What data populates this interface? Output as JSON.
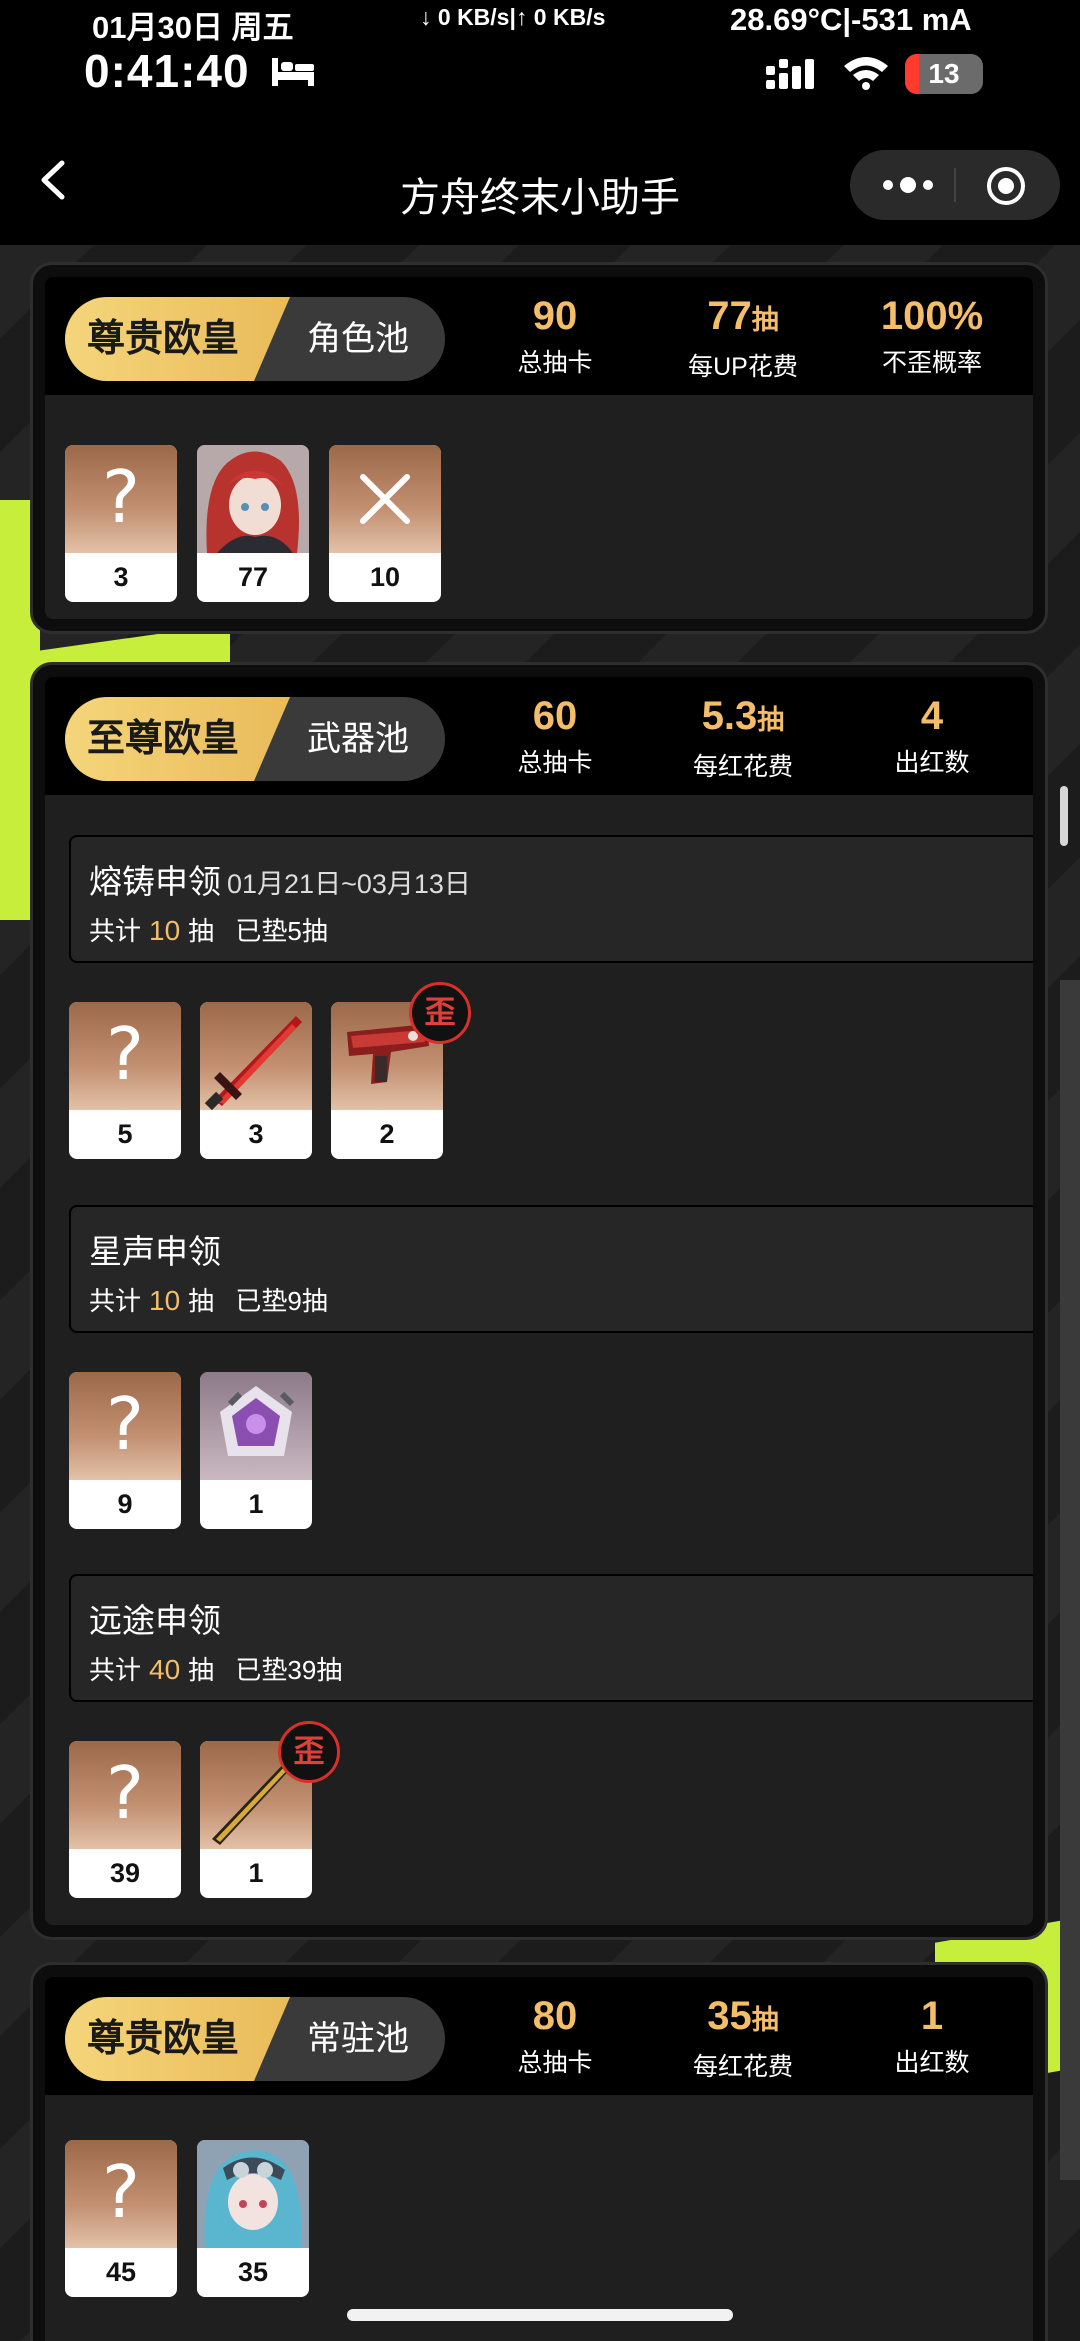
{
  "status_bar": {
    "date": "01月30日 周五",
    "time": "0:41:40",
    "network": "↓ 0 KB/s|↑ 0 KB/s",
    "temp_current": "28.69°C|-531 mA",
    "battery": "13"
  },
  "nav": {
    "title": "方舟终末小助手"
  },
  "cards": [
    {
      "rank": "尊贵欧皇",
      "pool": "角色池",
      "stats": [
        {
          "value": "90",
          "unit": "",
          "label": "总抽卡"
        },
        {
          "value": "77",
          "unit": "抽",
          "label": "每UP花费"
        },
        {
          "value": "100%",
          "unit": "",
          "label": "不歪概率"
        }
      ],
      "items": [
        {
          "type": "unknown",
          "glyph": "?",
          "count": "3"
        },
        {
          "type": "character-red-hair",
          "count": "77"
        },
        {
          "type": "cross",
          "glyph": "✕",
          "count": "10"
        }
      ]
    },
    {
      "rank": "至尊欧皇",
      "pool": "武器池",
      "stats": [
        {
          "value": "60",
          "unit": "",
          "label": "总抽卡"
        },
        {
          "value": "5.3",
          "unit": "抽",
          "label": "每红花费"
        },
        {
          "value": "4",
          "unit": "",
          "label": "出红数"
        }
      ],
      "banners": [
        {
          "name": "熔铸申领",
          "date": "01月21日~03月13日",
          "total_prefix": "共计",
          "total": "10",
          "total_unit": "抽",
          "pity": "已垫5抽",
          "items": [
            {
              "type": "unknown",
              "glyph": "?",
              "count": "5"
            },
            {
              "type": "red-sword",
              "count": "3"
            },
            {
              "type": "red-gun",
              "count": "2",
              "badge": "歪"
            }
          ]
        },
        {
          "name": "星声申领",
          "date": "",
          "total_prefix": "共计",
          "total": "10",
          "total_unit": "抽",
          "pity": "已垫9抽",
          "items": [
            {
              "type": "unknown",
              "glyph": "?",
              "count": "9"
            },
            {
              "type": "purple-gadget",
              "count": "1"
            }
          ]
        },
        {
          "name": "远途申领",
          "date": "",
          "total_prefix": "共计",
          "total": "40",
          "total_unit": "抽",
          "pity": "已垫39抽",
          "items": [
            {
              "type": "unknown",
              "glyph": "?",
              "count": "39"
            },
            {
              "type": "gold-staff",
              "count": "1",
              "badge": "歪"
            }
          ]
        }
      ]
    },
    {
      "rank": "尊贵欧皇",
      "pool": "常驻池",
      "stats": [
        {
          "value": "80",
          "unit": "",
          "label": "总抽卡"
        },
        {
          "value": "35",
          "unit": "抽",
          "label": "每红花费"
        },
        {
          "value": "1",
          "unit": "",
          "label": "出红数"
        }
      ],
      "items": [
        {
          "type": "unknown",
          "glyph": "?",
          "count": "45"
        },
        {
          "type": "character-blue-hair",
          "count": "35"
        }
      ]
    }
  ]
}
